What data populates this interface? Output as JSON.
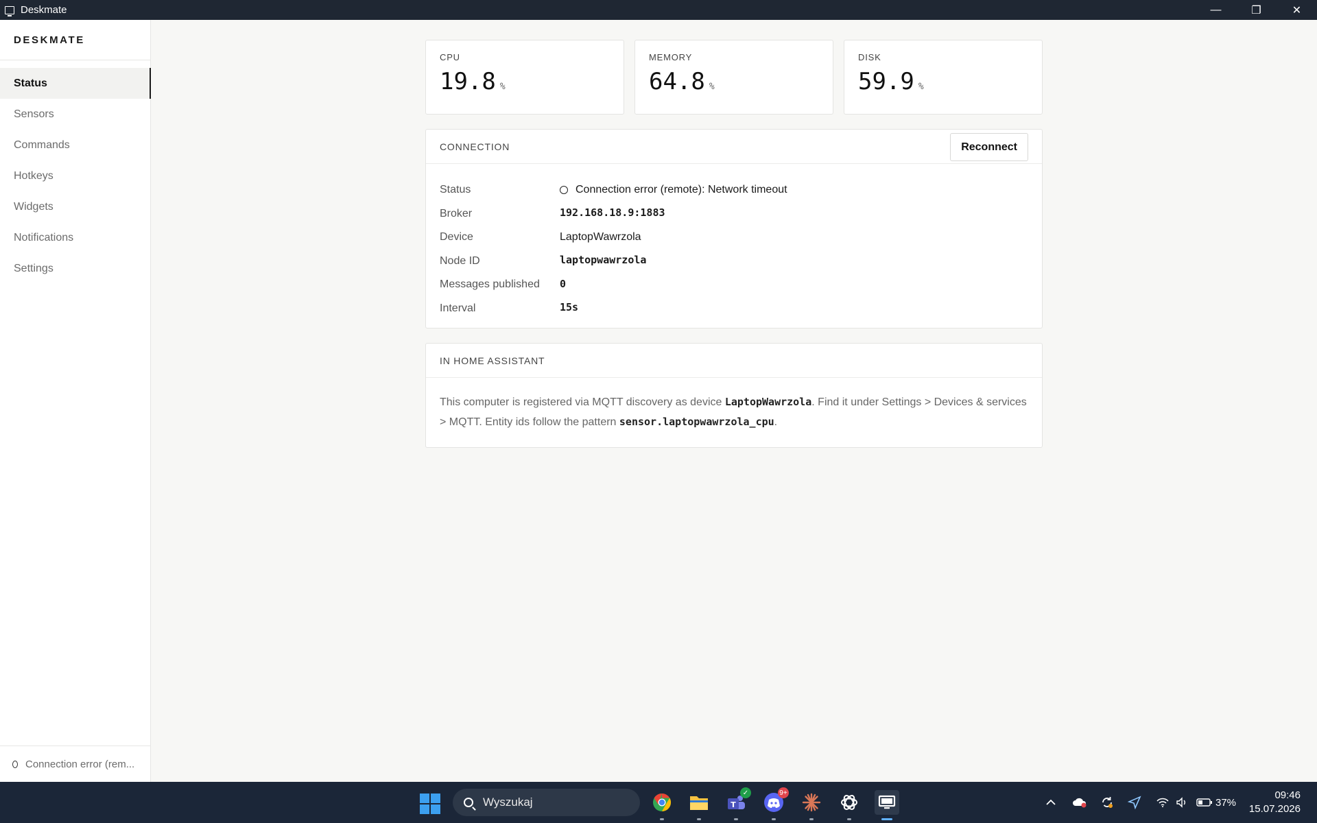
{
  "window": {
    "title": "Deskmate",
    "minimize": "—",
    "maximize": "❐",
    "close": "✕"
  },
  "sidebar": {
    "brand": "DESKMATE",
    "items": [
      {
        "label": "Status",
        "active": true
      },
      {
        "label": "Sensors"
      },
      {
        "label": "Commands"
      },
      {
        "label": "Hotkeys"
      },
      {
        "label": "Widgets"
      },
      {
        "label": "Notifications"
      },
      {
        "label": "Settings"
      }
    ],
    "footer_status": "Connection error (rem..."
  },
  "metrics": {
    "cpu": {
      "label": "CPU",
      "value": "19.8",
      "unit": "%"
    },
    "memory": {
      "label": "MEMORY",
      "value": "64.8",
      "unit": "%"
    },
    "disk": {
      "label": "DISK",
      "value": "59.9",
      "unit": "%"
    }
  },
  "connection": {
    "title": "CONNECTION",
    "reconnect_label": "Reconnect",
    "rows": {
      "status": {
        "key": "Status",
        "value": "Connection error (remote): Network timeout"
      },
      "broker": {
        "key": "Broker",
        "value": "192.168.18.9:1883"
      },
      "device": {
        "key": "Device",
        "value": "LaptopWawrzola"
      },
      "node_id": {
        "key": "Node ID",
        "value": "laptopwawrzola"
      },
      "messages": {
        "key": "Messages published",
        "value": "0"
      },
      "interval": {
        "key": "Interval",
        "value": "15s"
      }
    }
  },
  "home_assistant": {
    "title": "IN HOME ASSISTANT",
    "text_1": "This computer is registered via MQTT discovery as device ",
    "device_code": "LaptopWawrzola",
    "text_2": ". Find it under Settings > Devices & services > MQTT. Entity ids follow the pattern ",
    "pattern_code": "sensor.laptopwawrzola_cpu",
    "text_3": "."
  },
  "taskbar": {
    "search_placeholder": "Wyszukaj",
    "discord_badge": "9+",
    "battery": "37%",
    "time": "09:46",
    "date": "15.07.2026",
    "apps": [
      "chrome-icon",
      "file-explorer-icon",
      "teams-icon",
      "discord-icon",
      "claude-icon",
      "chatgpt-icon",
      "deskmate-icon"
    ]
  }
}
